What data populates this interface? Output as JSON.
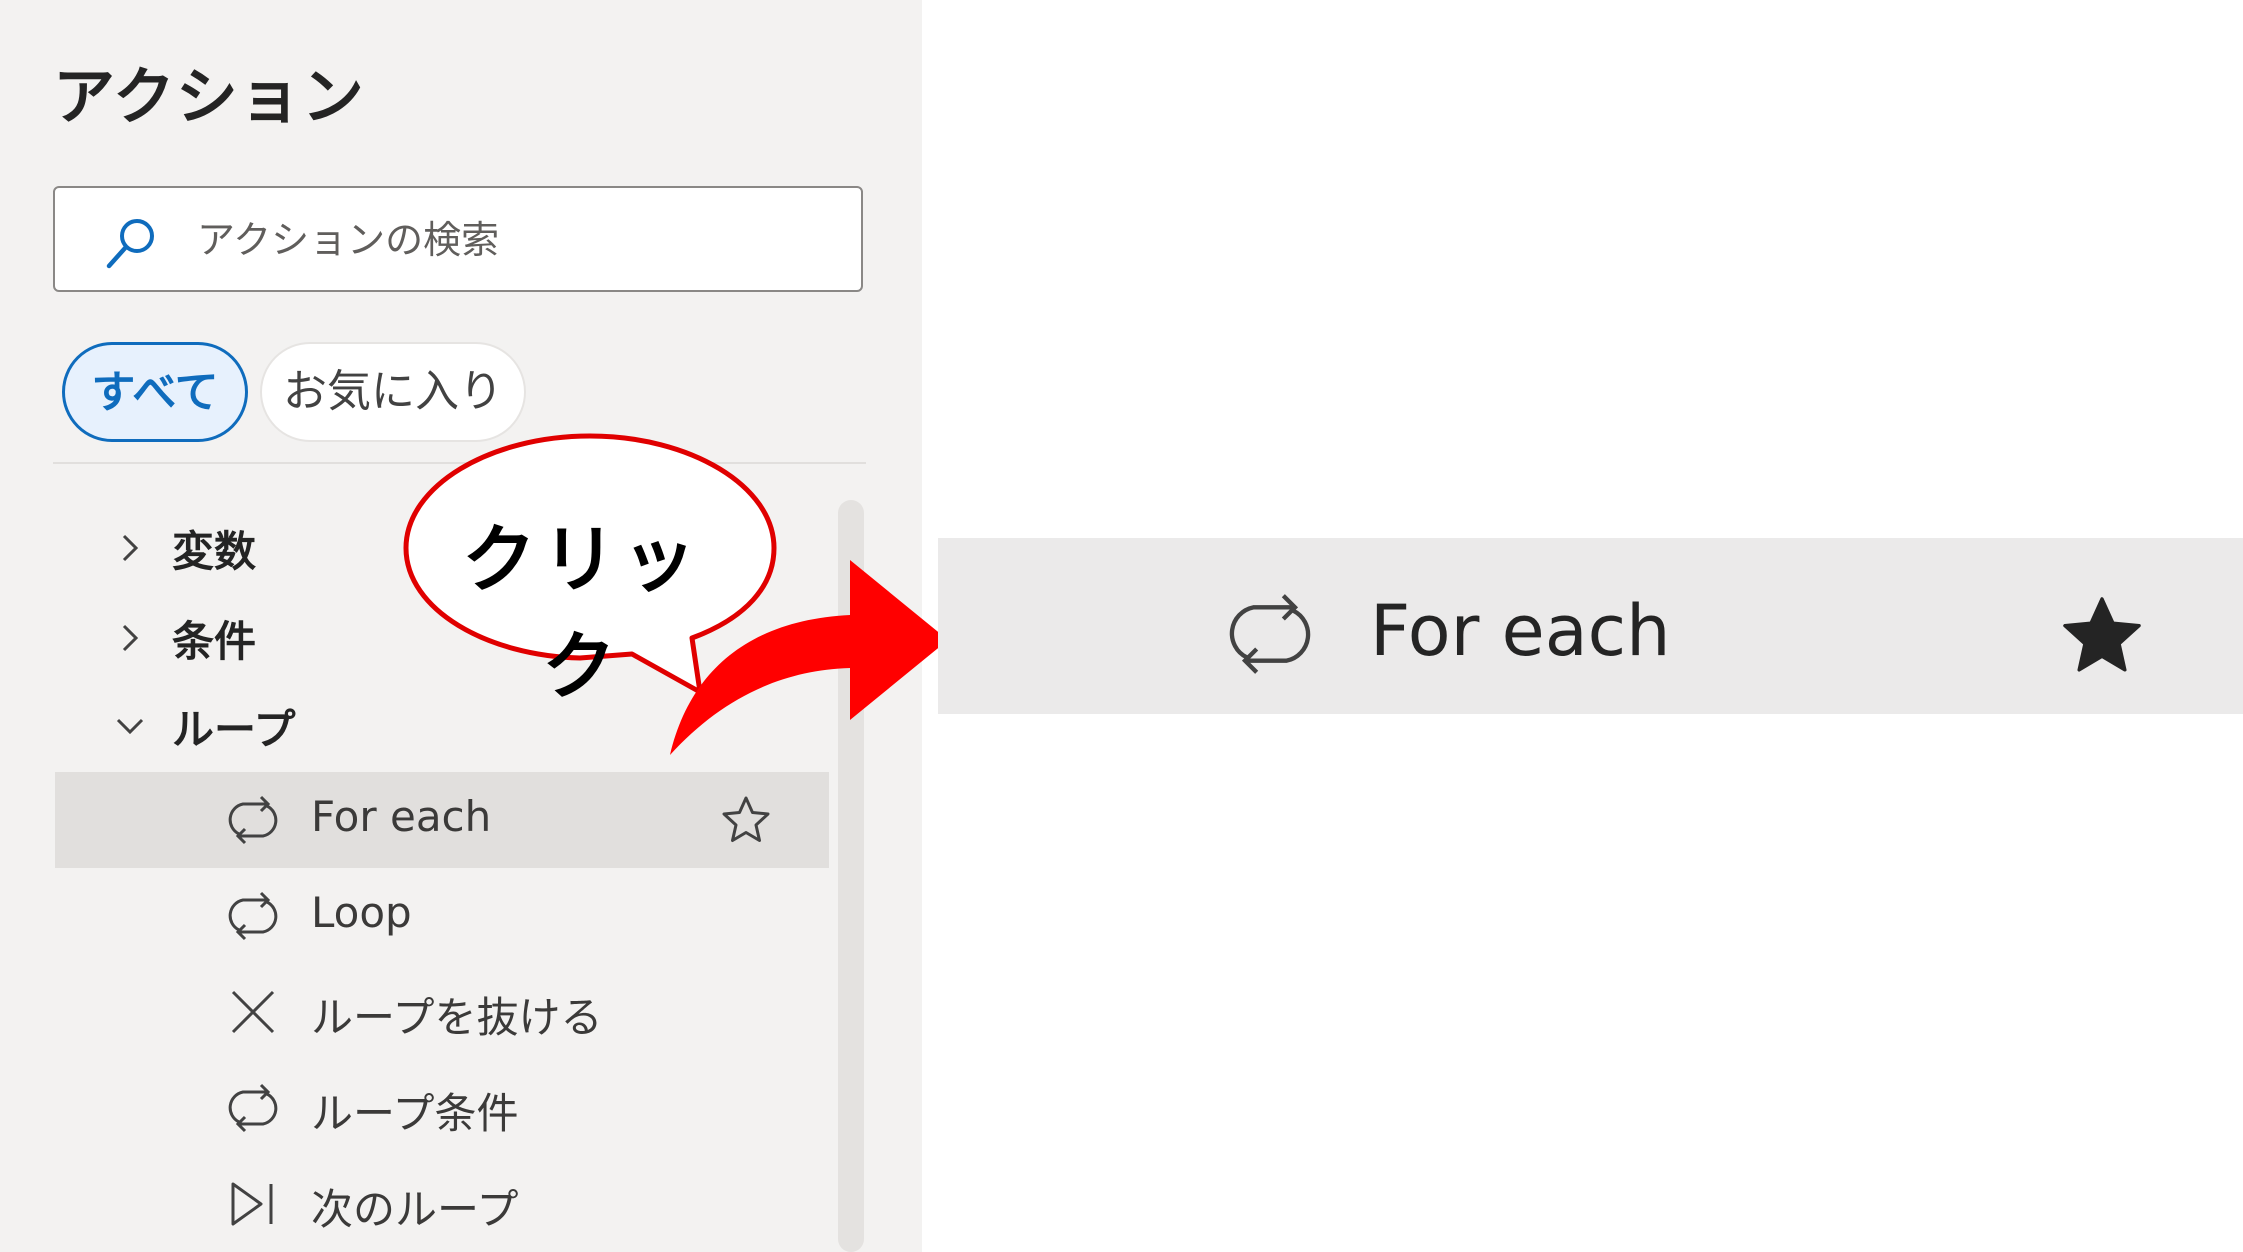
{
  "panel": {
    "title": "アクション",
    "search": {
      "placeholder": "アクションの検索",
      "value": ""
    },
    "tabs": [
      {
        "label": "すべて",
        "selected": true
      },
      {
        "label": "お気に入り",
        "selected": false
      }
    ],
    "groups": [
      {
        "label": "変数",
        "expanded": false,
        "icon": "chevron-right-icon"
      },
      {
        "label": "条件",
        "expanded": false,
        "icon": "chevron-right-icon"
      },
      {
        "label": "ループ",
        "expanded": true,
        "icon": "chevron-down-icon"
      }
    ],
    "loop_actions": [
      {
        "label": "For each",
        "icon": "loop-icon",
        "selected": true,
        "star": "star-outline-icon"
      },
      {
        "label": "Loop",
        "icon": "loop-icon"
      },
      {
        "label": "ループを抜ける",
        "icon": "close-icon"
      },
      {
        "label": "ループ条件",
        "icon": "loop-icon"
      },
      {
        "label": "次のループ",
        "icon": "next-loop-icon"
      }
    ]
  },
  "callout": {
    "text": "クリック",
    "border_color": "#e00000",
    "arrow_color": "#ff0000"
  },
  "zoom": {
    "label": "For each",
    "icon": "loop-icon",
    "star": "star-filled-icon"
  },
  "colors": {
    "panel_bg": "#f3f2f1",
    "accent": "#0f6cbd",
    "selected_row": "#e1dfdd"
  }
}
